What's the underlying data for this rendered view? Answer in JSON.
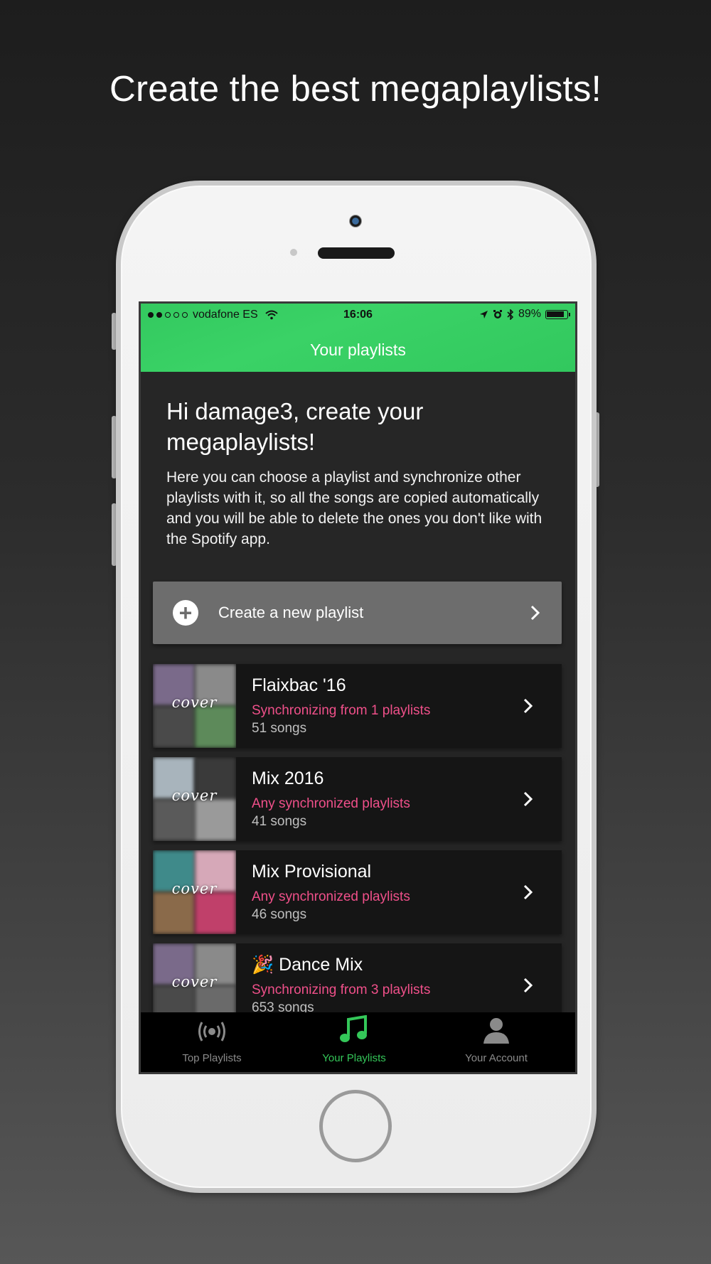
{
  "headline": "Create the best megaplaylists!",
  "colors": {
    "accent": "#34C759",
    "sync_text": "#F0508A",
    "create_button": "#6D6D6D"
  },
  "status_bar": {
    "carrier": "vodafone ES",
    "time": "16:06",
    "battery": "89%",
    "battery_level": 0.89,
    "signal_bars": 2
  },
  "nav": {
    "title": "Your playlists"
  },
  "intro": {
    "heading": "Hi damage3, create your megaplaylists!",
    "body": "Here you can choose a playlist and synchronize other playlists with it, so all the songs are copied automatically and you will be able to delete the ones you don't like with the Spotify app."
  },
  "create_button": {
    "label": "Create a new playlist",
    "icon": "plus-circle-icon"
  },
  "playlists": [
    {
      "cover_label": "cover",
      "name": "Flaixbac '16",
      "sync": "Synchronizing from 1 playlists",
      "songs": "51 songs"
    },
    {
      "cover_label": "cover",
      "name": "Mix 2016",
      "sync": "Any synchronized playlists",
      "songs": "41 songs"
    },
    {
      "cover_label": "cover",
      "name": "Mix Provisional",
      "sync": "Any synchronized playlists",
      "songs": "46 songs"
    },
    {
      "cover_label": "cover",
      "name": "🎉 Dance Mix",
      "sync": "Synchronizing from 3 playlists",
      "songs": "653 songs"
    }
  ],
  "tabs": [
    {
      "label": "Top Playlists",
      "icon": "broadcast-icon",
      "active": false
    },
    {
      "label": "Your Playlists",
      "icon": "music-note-icon",
      "active": true
    },
    {
      "label": "Your Account",
      "icon": "person-icon",
      "active": false
    }
  ]
}
